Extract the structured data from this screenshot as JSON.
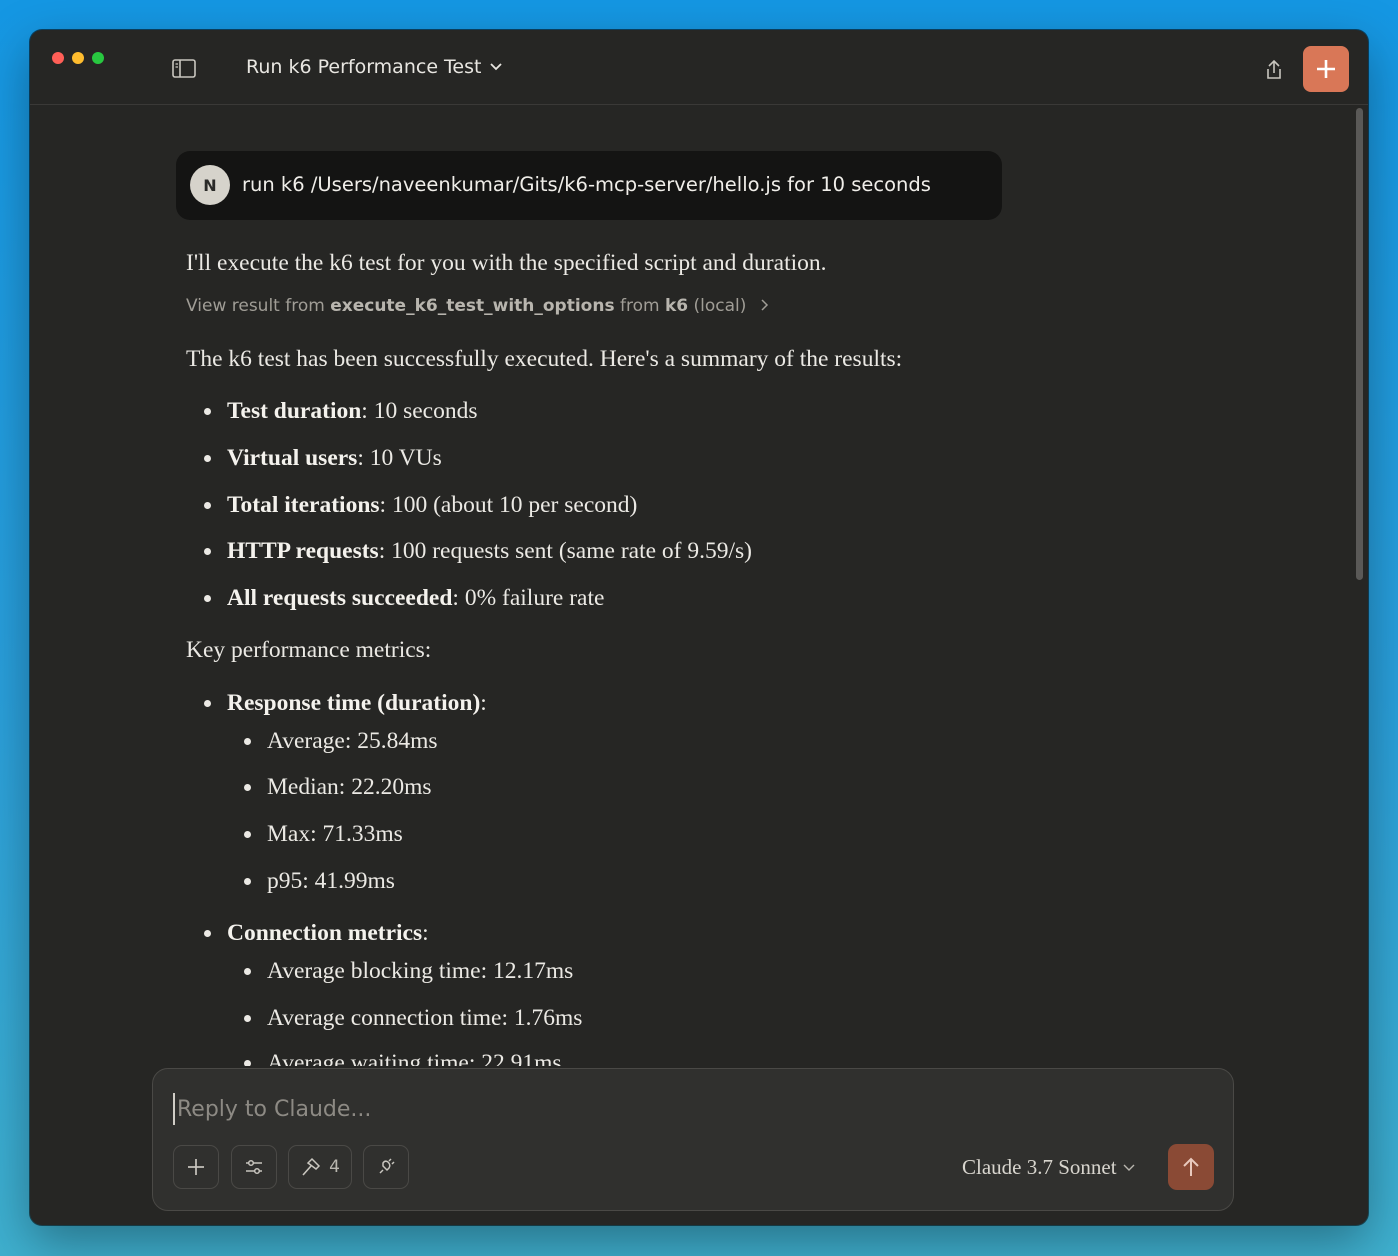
{
  "header": {
    "conversation_title": "Run k6 Performance Test"
  },
  "user_message": {
    "avatar_initial": "N",
    "text": "run k6 /Users/naveenkumar/Gits/k6-mcp-server/hello.js for 10 seconds"
  },
  "response": {
    "intro": "I'll execute the k6 test for you with the specified script and duration.",
    "tool_result": {
      "prefix": "View result from ",
      "tool_name": "execute_k6_test_with_options",
      "from_word": " from ",
      "server_name": "k6",
      "suffix": " (local)"
    },
    "summary_intro": "The k6 test has been successfully executed. Here's a summary of the results:",
    "summary_items": [
      {
        "label": "Test duration",
        "value": ": 10 seconds"
      },
      {
        "label": "Virtual users",
        "value": ": 10 VUs"
      },
      {
        "label": "Total iterations",
        "value": ": 100 (about 10 per second)"
      },
      {
        "label": "HTTP requests",
        "value": ": 100 requests sent (same rate of 9.59/s)"
      },
      {
        "label": "All requests succeeded",
        "value": ": 0% failure rate"
      }
    ],
    "metrics_intro": "Key performance metrics:",
    "response_time": {
      "label": "Response time (duration)",
      "colon": ":",
      "items": [
        "Average: 25.84ms",
        "Median: 22.20ms",
        "Max: 71.33ms",
        "p95: 41.99ms"
      ]
    },
    "connection": {
      "label": "Connection metrics",
      "colon": ":",
      "items": [
        "Average blocking time: 12.17ms",
        "Average connection time: 1.76ms",
        "Average waiting time: 22.91ms"
      ]
    }
  },
  "composer": {
    "placeholder": "Reply to Claude...",
    "tools_count": "4",
    "model": "Claude 3.7 Sonnet"
  },
  "colors": {
    "accent": "#d97757",
    "send_button": "#8a4a35",
    "window_bg": "#262624"
  }
}
